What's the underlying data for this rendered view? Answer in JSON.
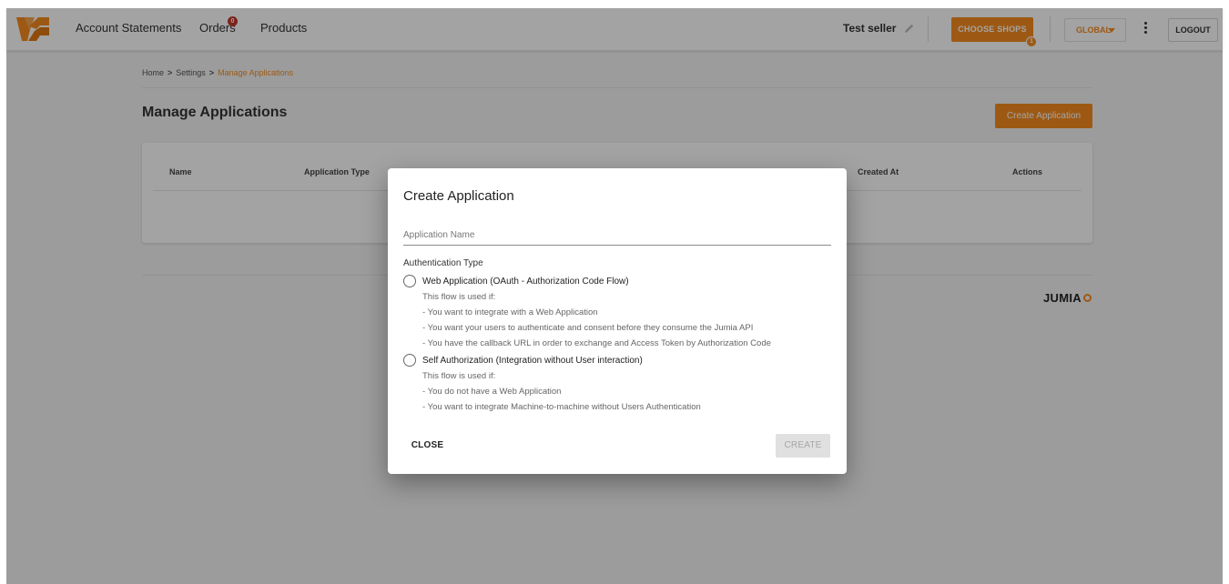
{
  "header": {
    "nav": [
      {
        "label": "Account Statements"
      },
      {
        "label": "Orders",
        "badge": "0"
      },
      {
        "label": "Products"
      }
    ],
    "seller_name": "Test seller",
    "choose_shops_label": "CHOOSE SHOPS",
    "choose_shops_badge": "1",
    "global_label": "GLOBAL",
    "logout_label": "LOGOUT"
  },
  "breadcrumb": {
    "home": "Home",
    "settings": "Settings",
    "current": "Manage Applications",
    "separator": ">"
  },
  "page": {
    "title": "Manage Applications",
    "create_button": "Create Application"
  },
  "table": {
    "columns": [
      "Name",
      "Application Type",
      "Created At",
      "Actions"
    ]
  },
  "footer": {
    "brand": "JUMIA"
  },
  "dialog": {
    "title": "Create Application",
    "name_placeholder": "Application Name",
    "auth_type_label": "Authentication Type",
    "options": [
      {
        "label": "Web Application (OAuth - Authorization Code Flow)",
        "intro": "This flow is used if:",
        "items": [
          "- You want to integrate with a Web Application",
          "- You want your users to authenticate and consent before they consume the Jumia API",
          "- You have the callback URL in order to exchange and Access Token by Authorization Code"
        ]
      },
      {
        "label": "Self Authorization (Integration without User interaction)",
        "intro": "This flow is used if:",
        "items": [
          "- You do not have a Web Application",
          "- You want to integrate Machine-to-machine without Users Authentication"
        ]
      }
    ],
    "close_label": "CLOSE",
    "create_label": "CREATE"
  },
  "colors": {
    "accent": "#f68b1e",
    "badge_red": "#c0392b",
    "overlay": "rgba(0,0,0,0.36)"
  }
}
